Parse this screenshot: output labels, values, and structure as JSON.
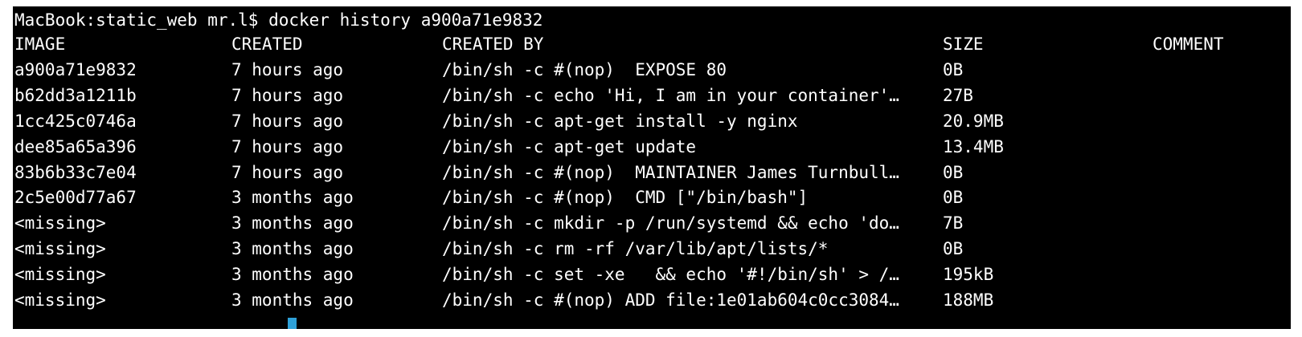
{
  "terminal": {
    "prompt_line": "MacBook:static_web mr.l$ docker history a900a71e9832",
    "headers": {
      "image": "IMAGE",
      "created": "CREATED",
      "created_by": "CREATED BY",
      "size": "SIZE",
      "comment": "COMMENT"
    },
    "rows": [
      {
        "image": "a900a71e9832",
        "created": "7 hours ago",
        "created_by": "/bin/sh -c #(nop)  EXPOSE 80",
        "size": "0B"
      },
      {
        "image": "b62dd3a1211b",
        "created": "7 hours ago",
        "created_by": "/bin/sh -c echo 'Hi, I am in your container'…",
        "size": "27B"
      },
      {
        "image": "1cc425c0746a",
        "created": "7 hours ago",
        "created_by": "/bin/sh -c apt-get install -y nginx",
        "size": "20.9MB"
      },
      {
        "image": "dee85a65a396",
        "created": "7 hours ago",
        "created_by": "/bin/sh -c apt-get update",
        "size": "13.4MB"
      },
      {
        "image": "83b6b33c7e04",
        "created": "7 hours ago",
        "created_by": "/bin/sh -c #(nop)  MAINTAINER James Turnbull…",
        "size": "0B"
      },
      {
        "image": "2c5e00d77a67",
        "created": "3 months ago",
        "created_by": "/bin/sh -c #(nop)  CMD [\"/bin/bash\"]",
        "size": "0B"
      },
      {
        "image": "<missing>",
        "created": "3 months ago",
        "created_by": "/bin/sh -c mkdir -p /run/systemd && echo 'do…",
        "size": "7B"
      },
      {
        "image": "<missing>",
        "created": "3 months ago",
        "created_by": "/bin/sh -c rm -rf /var/lib/apt/lists/*",
        "size": "0B"
      },
      {
        "image": "<missing>",
        "created": "3 months ago",
        "created_by": "/bin/sh -c set -xe   && echo '#!/bin/sh' > /…",
        "size": "195kB"
      },
      {
        "image": "<missing>",
        "created": "3 months ago",
        "created_by": "/bin/sh -c #(nop) ADD file:1e01ab604c0cc3084…",
        "size": "188MB"
      }
    ]
  }
}
